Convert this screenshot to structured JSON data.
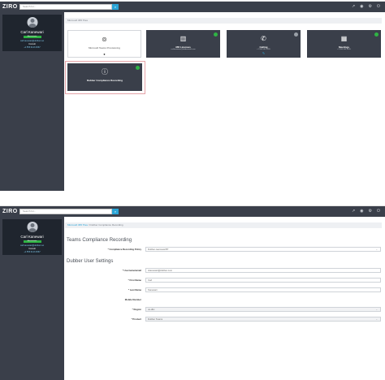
{
  "app": {
    "logo": "ZIRO"
  },
  "search": {
    "placeholder": "Search for...",
    "button": "⌕"
  },
  "top_icons": [
    "chart-icon",
    "eye-icon",
    "gear-icon",
    "power-icon"
  ],
  "top_icon_glyphs": [
    "↗",
    "◉",
    "⚙",
    "⏻"
  ],
  "profile": {
    "name": "Carl Kanewari",
    "badge": "Administrator",
    "email": "carl.kanewari@dubber.net",
    "role": "Consult",
    "phone": "+1 555 0123 4567"
  },
  "panel1": {
    "breadcrumb": "Microsoft 365 Tiles",
    "tiles": [
      {
        "title": "Microsoft Teams Provisioning",
        "sub": "",
        "icon": "⊚",
        "status": "none",
        "style": "light",
        "icon_name": "teams-icon"
      },
      {
        "title": "365 Licenses",
        "sub": "carlkanewari@dubbermsft.com",
        "icon": "▥",
        "status": "green",
        "style": "dark",
        "icon_name": "license-icon"
      },
      {
        "title": "Calling",
        "sub": "+1 555 555 5555",
        "icon": "✆",
        "status": "gray",
        "style": "dark",
        "icon_name": "phone-icon"
      },
      {
        "title": "Meetings",
        "sub": "+1 555 555 5555",
        "icon": "▦",
        "status": "green",
        "style": "dark",
        "icon_name": "calendar-icon"
      },
      {
        "title": "Dubber Compliance Recording",
        "sub": "",
        "icon": "ⓘ",
        "status": "green",
        "style": "dark",
        "icon_name": "recording-icon"
      }
    ]
  },
  "panel2": {
    "breadcrumb_link": "Microsoft 365 Tiles",
    "breadcrumb_sep": " / ",
    "breadcrumb_current": "Dubber Compliance Recording",
    "heading1": "Teams Compliance Recording",
    "policy_label": "* Compliance Recording Policy",
    "policy_value": "Dubber-teamsusrPP",
    "heading2": "Dubber User Settings",
    "fields": [
      {
        "label": "* Username/email",
        "value": "ckanewari@dubber.com",
        "disabled": false,
        "select": false
      },
      {
        "label": "* First Name",
        "value": "Carl",
        "disabled": false,
        "select": false
      },
      {
        "label": "* Last Name",
        "value": "Kanewari",
        "disabled": false,
        "select": false
      },
      {
        "label": "Mobile Number",
        "value": "",
        "disabled": false,
        "select": false
      },
      {
        "label": "* Region",
        "value": "us-dbx",
        "disabled": true,
        "select": true
      },
      {
        "label": "* Product",
        "value": "Dubber Teams",
        "disabled": true,
        "select": true
      }
    ]
  },
  "colors": {
    "topbar": "#3a3f4a",
    "sidebar": "#3a3f4a",
    "accent": "#2aa4d6",
    "green": "#2fb344"
  }
}
